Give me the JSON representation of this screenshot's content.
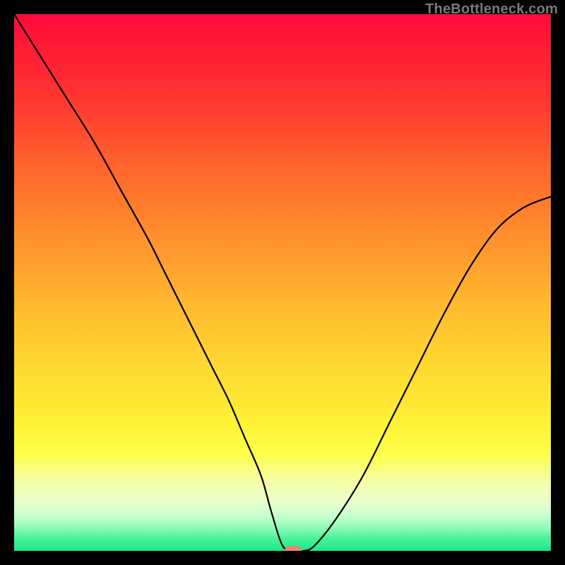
{
  "watermark": "TheBottleneck.com",
  "chart_data": {
    "type": "line",
    "title": "",
    "xlabel": "",
    "ylabel": "",
    "xlim": [
      0,
      100
    ],
    "ylim": [
      0,
      100
    ],
    "grid": false,
    "legend": false,
    "marker": {
      "x": 52,
      "y": 0,
      "color": "#e8856f"
    },
    "series": [
      {
        "name": "bottleneck-curve",
        "color": "#000000",
        "x": [
          0,
          5,
          10,
          15,
          20,
          25,
          28,
          31,
          34,
          37,
          40,
          43,
          46,
          48,
          50,
          52,
          54,
          56,
          60,
          65,
          70,
          75,
          80,
          85,
          90,
          95,
          100
        ],
        "y": [
          100,
          92,
          84,
          76,
          67,
          58,
          52,
          46,
          40,
          34,
          28,
          21,
          14,
          7,
          1,
          0,
          0,
          1,
          6,
          14,
          24,
          34,
          44,
          53,
          60,
          64,
          66
        ]
      }
    ],
    "background_gradient": {
      "stops": [
        {
          "pos": 0.0,
          "color": "#ff0b3a"
        },
        {
          "pos": 0.08,
          "color": "#ff1f33"
        },
        {
          "pos": 0.18,
          "color": "#ff3e2f"
        },
        {
          "pos": 0.3,
          "color": "#ff6a2c"
        },
        {
          "pos": 0.42,
          "color": "#ff922d"
        },
        {
          "pos": 0.55,
          "color": "#ffbb2f"
        },
        {
          "pos": 0.66,
          "color": "#ffda31"
        },
        {
          "pos": 0.76,
          "color": "#fff134"
        },
        {
          "pos": 0.82,
          "color": "#feff4a"
        },
        {
          "pos": 0.86,
          "color": "#f6ff96"
        },
        {
          "pos": 0.89,
          "color": "#efffbc"
        },
        {
          "pos": 0.915,
          "color": "#e2ffd0"
        },
        {
          "pos": 0.935,
          "color": "#c6ffce"
        },
        {
          "pos": 0.955,
          "color": "#96fcbb"
        },
        {
          "pos": 0.975,
          "color": "#4ef29f"
        },
        {
          "pos": 1.0,
          "color": "#18e884"
        }
      ]
    }
  }
}
